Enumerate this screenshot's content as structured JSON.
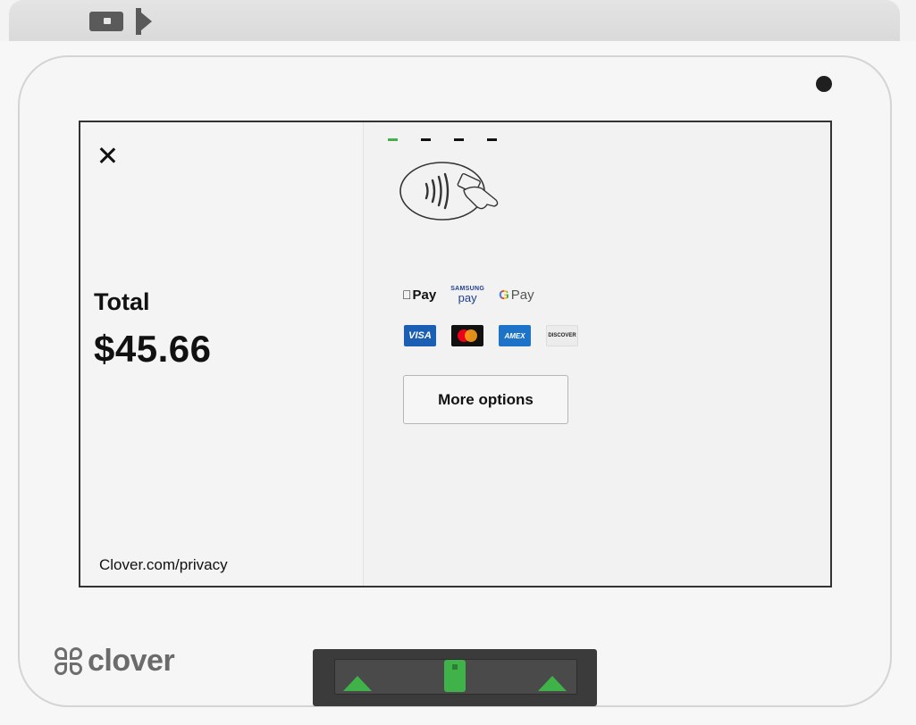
{
  "screen": {
    "left": {
      "total_label": "Total",
      "total_amount": "$45.66",
      "privacy_link": "Clover.com/privacy"
    },
    "right": {
      "progress_steps": 4,
      "progress_active_index": 0,
      "wallets": {
        "apple_pay": "Pay",
        "samsung_pay_top": "SAMSUNG",
        "samsung_pay_bottom": "pay",
        "google_pay_g": "G",
        "google_pay": "Pay"
      },
      "cards": {
        "visa": "VISA",
        "amex": "AMEX",
        "discover": "DISCOVER"
      },
      "more_options_label": "More options"
    }
  },
  "brand": {
    "wordmark": "clover"
  },
  "colors": {
    "accent_green": "#48b04b",
    "reader_green": "#3fb24a",
    "visa_blue": "#1a5fb4",
    "amex_blue": "#1d73c7"
  },
  "icons": [
    "card-slot-icon",
    "slot-arrow-icon",
    "camera",
    "close-icon",
    "contactless-tap-icon",
    "apple-logo-icon",
    "clover-mark-icon",
    "reader-arrow-icon",
    "reader-card-icon"
  ]
}
